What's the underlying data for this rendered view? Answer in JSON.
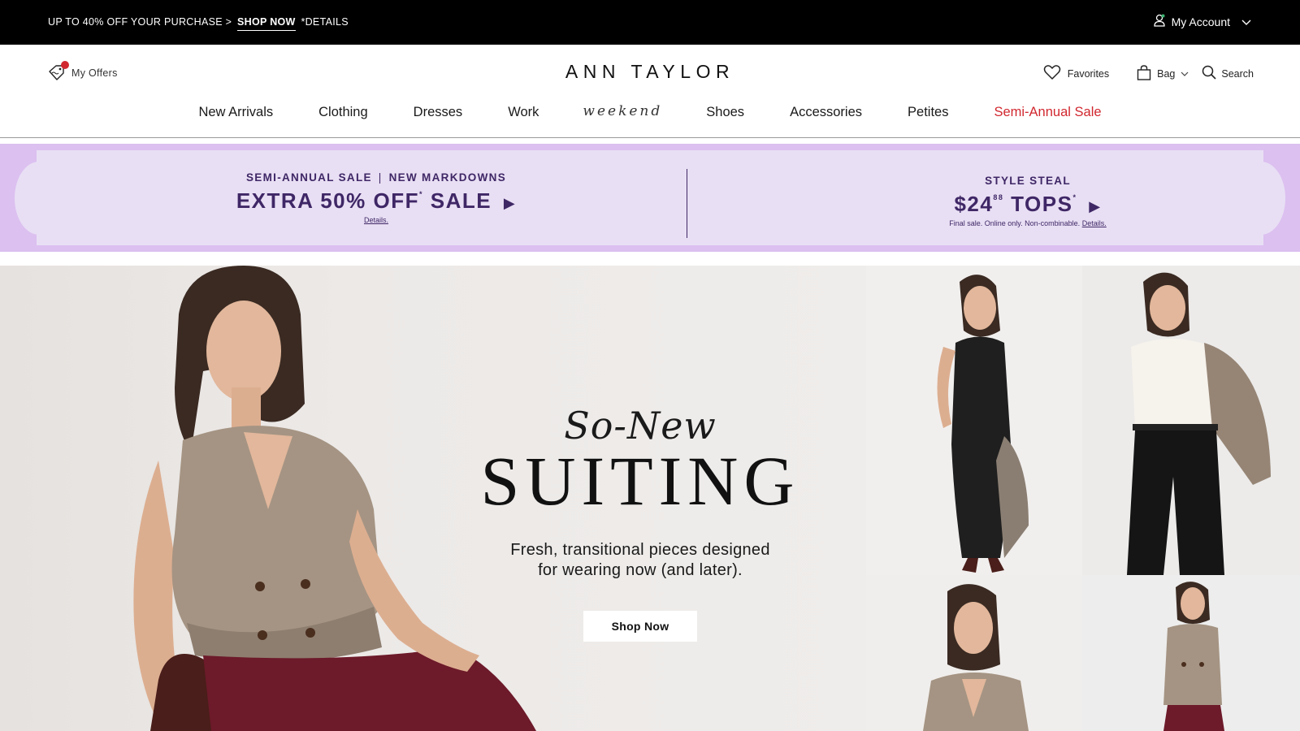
{
  "topbar": {
    "promo_prefix": "UP TO 40% OFF YOUR PURCHASE >",
    "promo_link": "SHOP NOW",
    "promo_suffix": "*DETAILS",
    "account_label": "My Account"
  },
  "header": {
    "offers_label": "My Offers",
    "logo": "ANN TAYLOR",
    "favorites_label": "Favorites",
    "bag_label": "Bag",
    "search_label": "Search"
  },
  "nav": {
    "items": [
      {
        "label": "New Arrivals"
      },
      {
        "label": "Clothing"
      },
      {
        "label": "Dresses"
      },
      {
        "label": "Work"
      },
      {
        "label": "weekend"
      },
      {
        "label": "Shoes"
      },
      {
        "label": "Accessories"
      },
      {
        "label": "Petites"
      },
      {
        "label": "Semi-Annual Sale"
      }
    ],
    "sale_color": "#d1282f"
  },
  "sale_banner": {
    "left": {
      "kicker_a": "SEMI-ANNUAL SALE",
      "kicker_b": "NEW MARKDOWNS",
      "headline": "EXTRA 50% OFF",
      "headline_mark": "*",
      "headline_tail": "SALE",
      "arrow": "▶",
      "details": "Details."
    },
    "right": {
      "kicker": "STYLE STEAL",
      "price_dollars": "$24",
      "price_cents": "88",
      "headline_tail": "TOPS",
      "headline_mark": "*",
      "arrow": "▶",
      "fine_print": "Final sale. Online only. Non-combinable.",
      "details": "Details."
    },
    "text_color": "#3f2766",
    "band_color": "#dcc0f0",
    "inner_color": "#e8dff4"
  },
  "hero": {
    "script": "So-New",
    "title": "SUITING",
    "subtitle_line1": "Fresh, transitional pieces designed",
    "subtitle_line2": "for wearing now (and later).",
    "cta": "Shop Now"
  }
}
